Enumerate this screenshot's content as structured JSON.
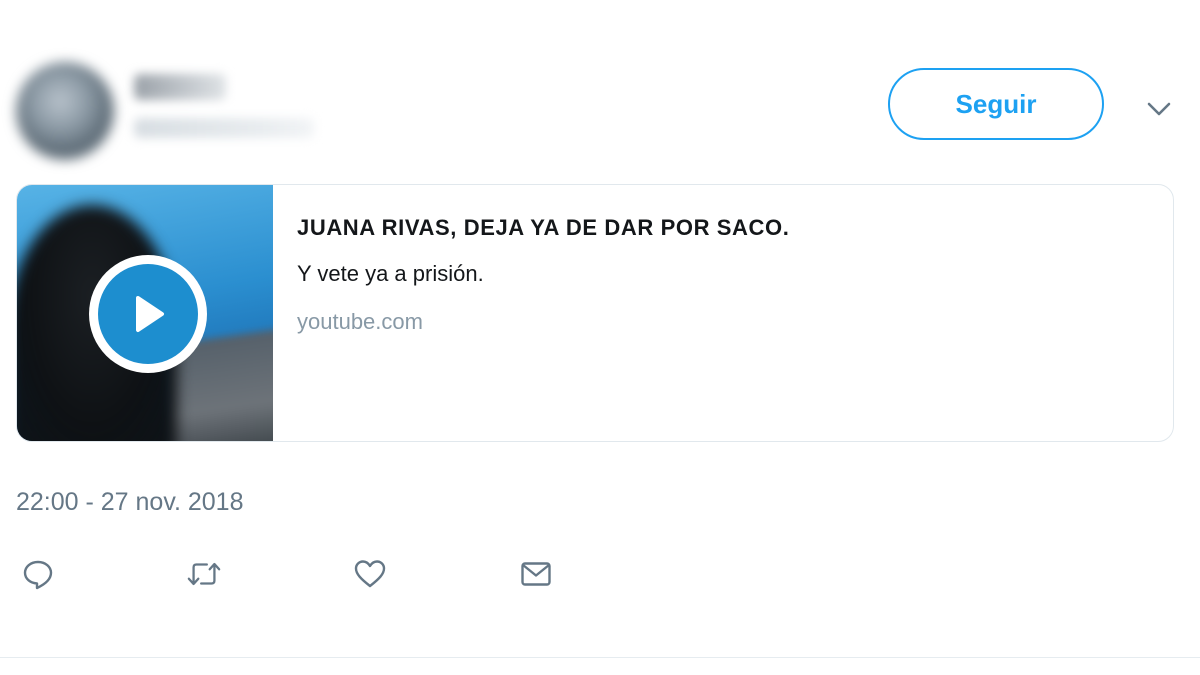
{
  "header": {
    "follow_label": "Seguir",
    "caret_icon": "chevron-down-icon"
  },
  "card": {
    "title": "JUANA RIVAS, DEJA YA DE DAR POR SACO.",
    "description": "Y vete ya a prisión.",
    "domain": "youtube.com",
    "play_icon": "play-icon"
  },
  "timestamp": "22:00 - 27 nov. 2018",
  "actions": [
    {
      "icon": "reply-icon"
    },
    {
      "icon": "retweet-icon"
    },
    {
      "icon": "heart-icon"
    },
    {
      "icon": "mail-icon"
    }
  ],
  "colors": {
    "accent": "#1da1f2",
    "muted": "#657786",
    "domain": "#8899a6",
    "border": "#e1e8ed",
    "play": "#1d8ecf"
  }
}
